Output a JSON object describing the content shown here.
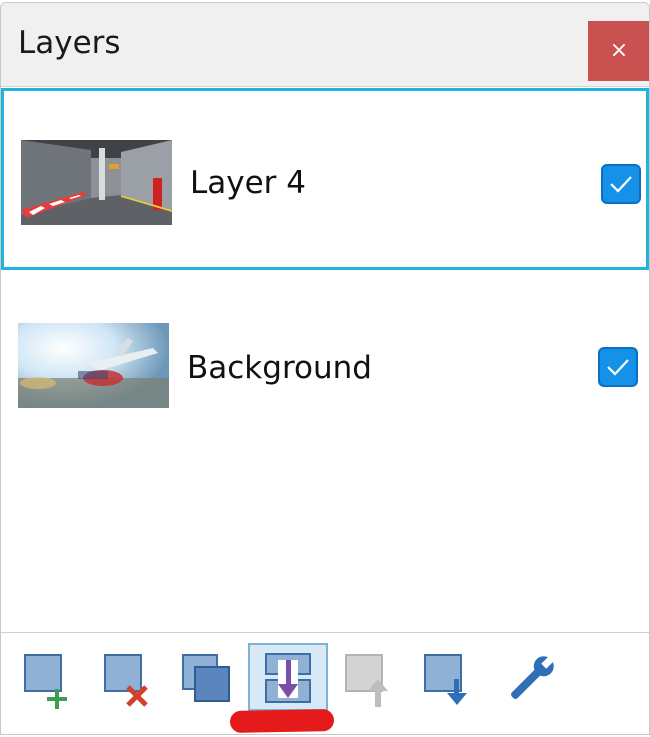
{
  "window": {
    "title": "Layers",
    "close_glyph": "×"
  },
  "layers": [
    {
      "name": "Layer 4",
      "visible": true,
      "selected": true,
      "thumbnail": "airport-terminal-photo"
    },
    {
      "name": "Background",
      "visible": true,
      "selected": false,
      "thumbnail": "blurred-airplane-photo"
    }
  ],
  "toolbar": {
    "tools": [
      {
        "name": "add-layer",
        "icon": "add-layer-icon",
        "enabled": true
      },
      {
        "name": "delete-layer",
        "icon": "delete-layer-icon",
        "enabled": true
      },
      {
        "name": "duplicate-layer",
        "icon": "duplicate-layer-icon",
        "enabled": true
      },
      {
        "name": "merge-layer-down",
        "icon": "merge-down-icon",
        "enabled": true,
        "active": true
      },
      {
        "name": "move-layer-up",
        "icon": "move-up-icon",
        "enabled": false
      },
      {
        "name": "move-layer-down",
        "icon": "move-down-icon",
        "enabled": true
      },
      {
        "name": "layer-properties",
        "icon": "wrench-icon",
        "enabled": true
      }
    ]
  },
  "colors": {
    "selection_border": "#1fb3e0",
    "close_button": "#c9514f",
    "checkbox": "#1592e8",
    "annotation": "#e51a1a"
  }
}
